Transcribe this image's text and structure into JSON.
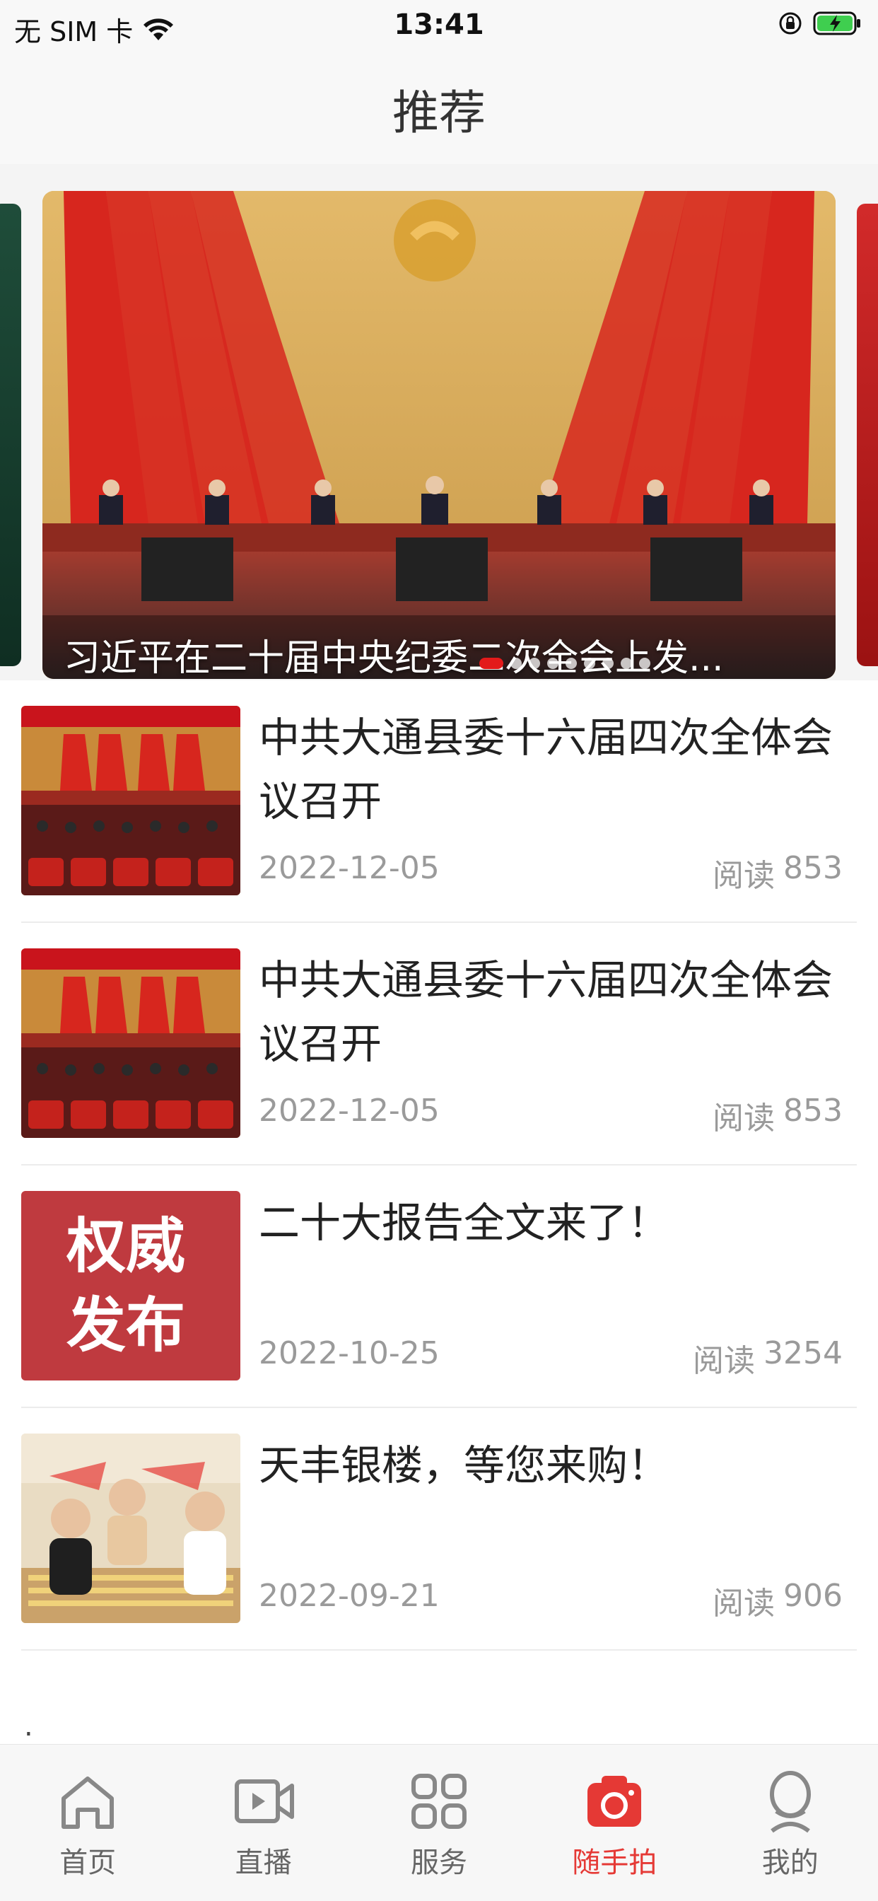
{
  "status_bar": {
    "carrier": "无 SIM 卡",
    "time": "13:41"
  },
  "nav": {
    "title": "推荐"
  },
  "carousel": {
    "caption": "习近平在二十届中央纪委二次全会上发...",
    "dot_count": 9,
    "active_dot": 0
  },
  "news": [
    {
      "title": "中共大通县委十六届四次全体会议召开",
      "date": "2022-12-05",
      "reads_label": "阅读",
      "reads": "853",
      "thumb": "meeting-hall-photo"
    },
    {
      "title": "中共大通县委十六届四次全体会议召开",
      "date": "2022-12-05",
      "reads_label": "阅读",
      "reads": "853",
      "thumb": "meeting-hall-photo"
    },
    {
      "title": "二十大报告全文来了！",
      "date": "2022-10-25",
      "reads_label": "阅读",
      "reads": "3254",
      "thumb": "authority-release-banner",
      "thumb_text": [
        "权威",
        "发布"
      ]
    },
    {
      "title": "天丰银楼，等您来购！",
      "date": "2022-09-21",
      "reads_label": "阅读",
      "reads": "906",
      "thumb": "jewelry-store-photo"
    }
  ],
  "more_indicator": ".",
  "tabs": [
    {
      "label": "首页",
      "icon": "home-icon",
      "active": false
    },
    {
      "label": "直播",
      "icon": "live-video-icon",
      "active": false
    },
    {
      "label": "服务",
      "icon": "services-grid-icon",
      "active": false
    },
    {
      "label": "随手拍",
      "icon": "camera-icon",
      "active": true
    },
    {
      "label": "我的",
      "icon": "profile-icon",
      "active": false
    }
  ],
  "colors": {
    "accent": "#e53935",
    "text": "#222222",
    "muted": "#9a9a9a",
    "background": "#f8f8f8"
  }
}
